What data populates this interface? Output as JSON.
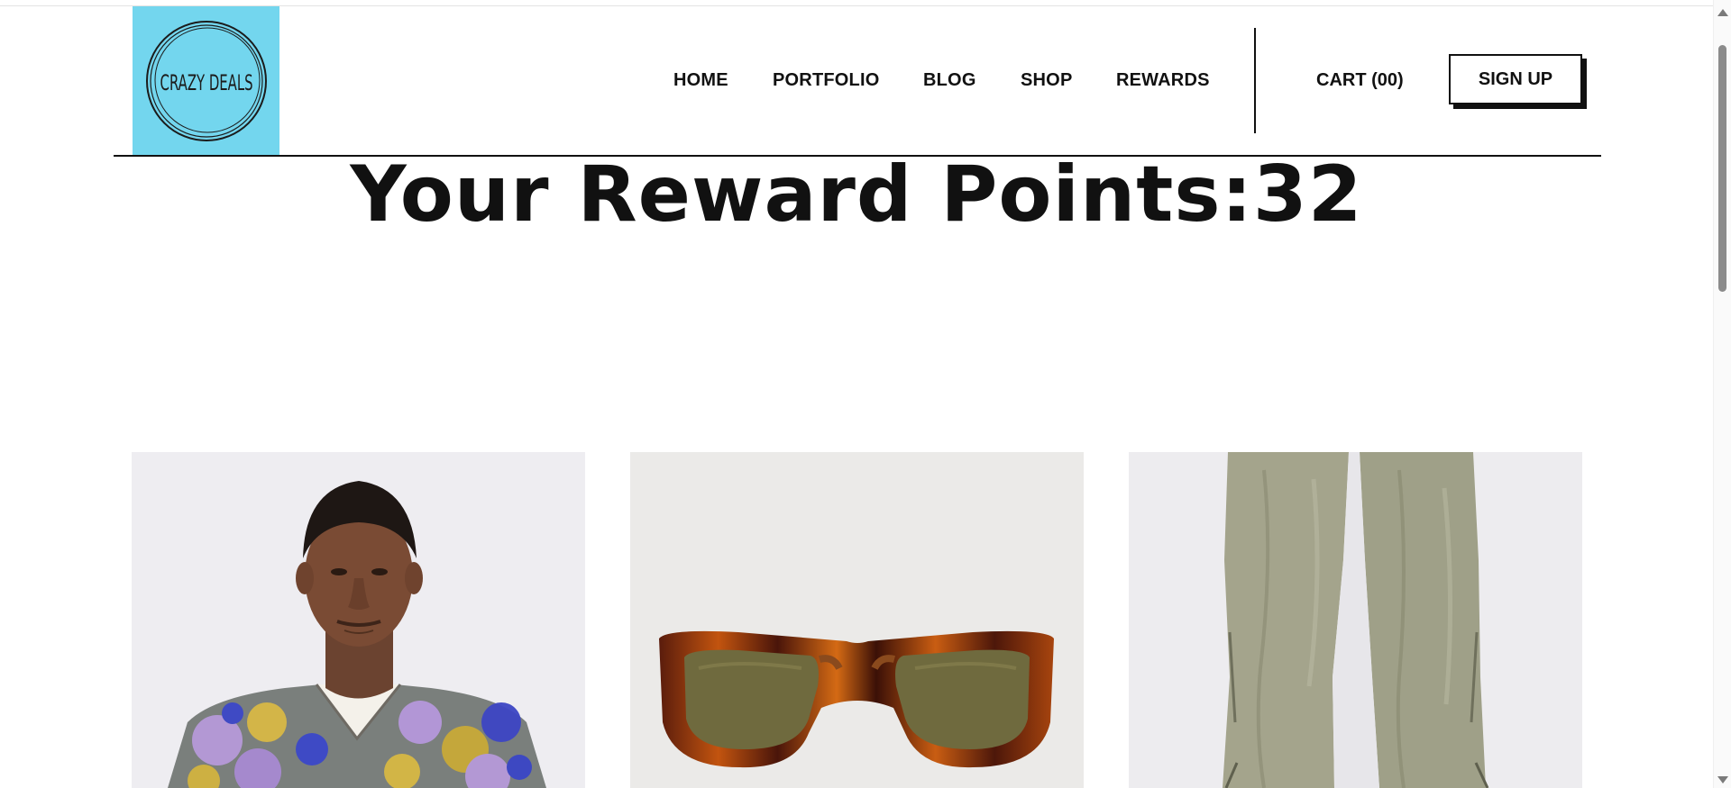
{
  "brand": {
    "logo_text": "CRAZY DEALS",
    "logo_bg": "#73d6ee"
  },
  "nav": {
    "items": [
      {
        "label": "HOME"
      },
      {
        "label": "PORTFOLIO"
      },
      {
        "label": "BLOG"
      },
      {
        "label": "SHOP"
      },
      {
        "label": "REWARDS"
      }
    ],
    "cart_label": "CART (00)",
    "signup_label": "SIGN UP"
  },
  "rewards": {
    "title": "Your Reward Points:32"
  },
  "products": [
    {
      "image": "man-in-floral-shirt-photo"
    },
    {
      "image": "tortoiseshell-sunglasses-photo"
    },
    {
      "image": "olive-cargo-pants-photo"
    }
  ]
}
